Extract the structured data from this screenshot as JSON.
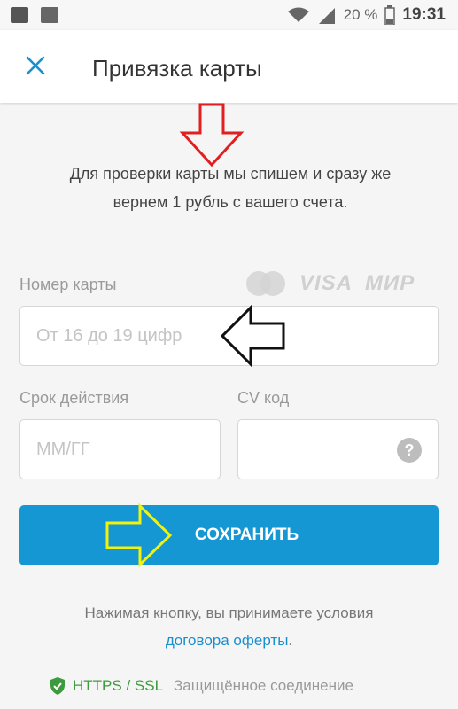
{
  "status_bar": {
    "battery_percent": "20 %",
    "time": "19:31",
    "icons": [
      "notes-icon",
      "image-icon",
      "wifi-icon",
      "signal-icon",
      "battery-icon"
    ]
  },
  "appbar": {
    "close_icon": "close-icon",
    "title": "Привязка карты"
  },
  "info": {
    "line1": "Для проверки карты мы спишем и сразу же",
    "line2": "вернем 1 рубль с вашего счета."
  },
  "card_number": {
    "label": "Номер карты",
    "placeholder": "От 16 до 19 цифр",
    "value": ""
  },
  "card_brands": {
    "visa": "VISA",
    "mir": "МИР",
    "mastercard_icon": "mastercard-icon"
  },
  "expiry": {
    "label": "Срок действия",
    "placeholder": "ММ/ГГ",
    "value": ""
  },
  "cvv": {
    "label": "CV код",
    "placeholder": "",
    "value": "",
    "help_text": "?"
  },
  "save_button": {
    "label": "СОХРАНИТЬ"
  },
  "terms": {
    "text": "Нажимая кнопку, вы принимаете условия",
    "link": "договора оферты",
    "suffix": "."
  },
  "security": {
    "protocol": "HTTPS / SSL",
    "text": "Защищённое соединение"
  },
  "colors": {
    "accent": "#1597d3",
    "link": "#1a8fce",
    "secure_green": "#3d9a3d",
    "arrow_red": "#e02020",
    "arrow_black": "#111111",
    "arrow_yellow": "#f2f20a"
  }
}
